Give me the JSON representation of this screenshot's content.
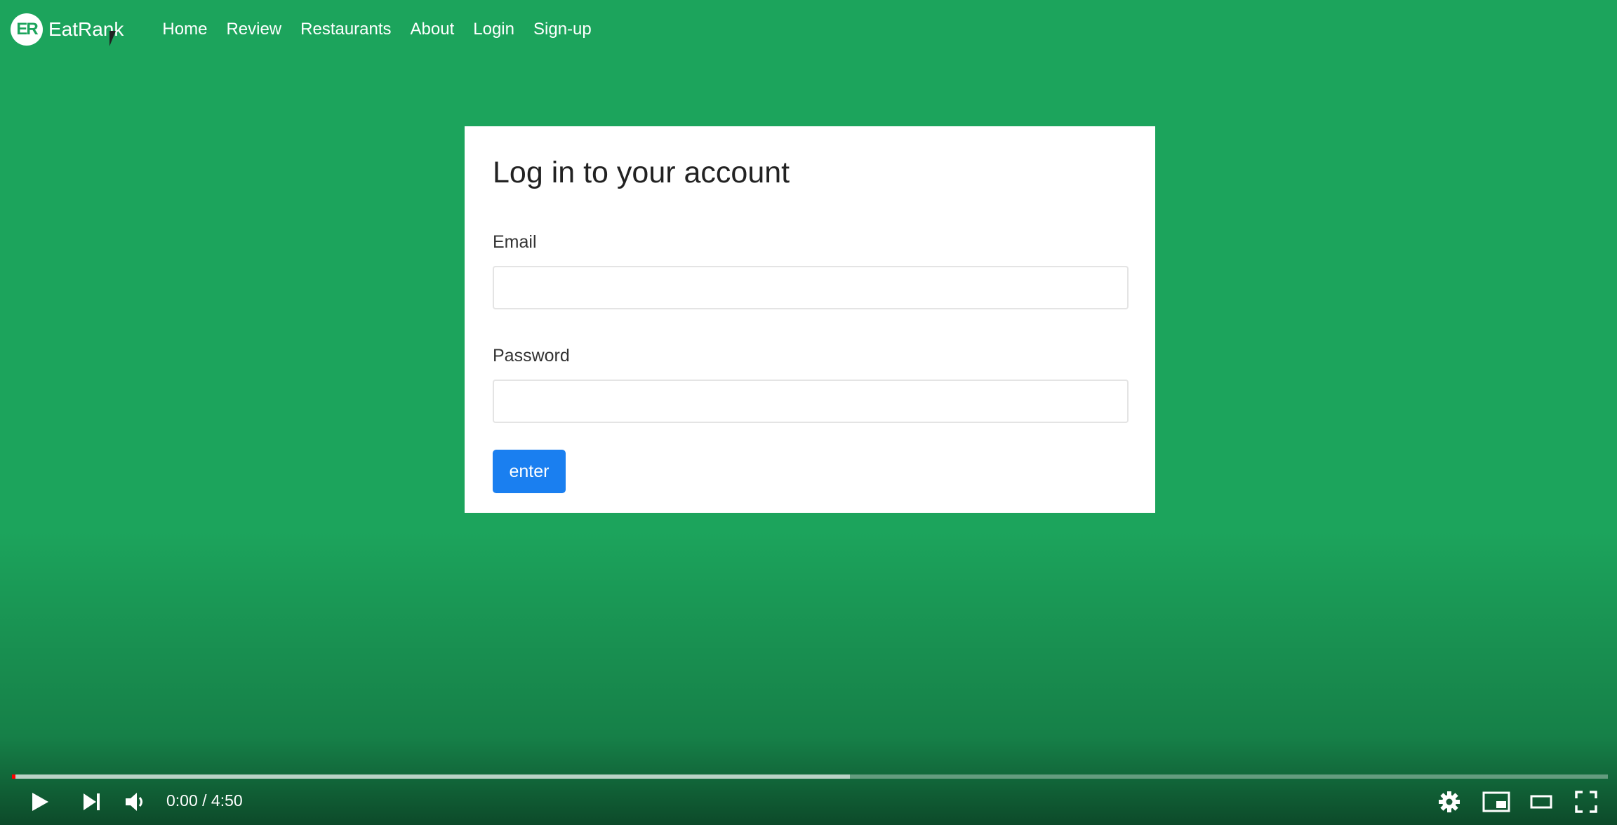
{
  "brand": {
    "logo_text": "ER",
    "name": "EatRank"
  },
  "nav": {
    "items": [
      "Home",
      "Review",
      "Restaurants",
      "About",
      "Login",
      "Sign-up"
    ]
  },
  "login": {
    "title": "Log in to your account",
    "email_label": "Email",
    "email_value": "",
    "password_label": "Password",
    "password_value": "",
    "submit_label": "enter"
  },
  "player": {
    "current_time": "0:00",
    "duration": "4:50",
    "time_text": "0:00 / 4:50",
    "buffered_fraction": 0.525,
    "played_fraction": 0.0,
    "icons": [
      "play-icon",
      "next-icon",
      "volume-icon",
      "settings-icon",
      "miniplayer-icon",
      "theater-mode-icon",
      "fullscreen-icon"
    ]
  },
  "colors": {
    "background": "#1ca45c",
    "button": "#1a7ff0",
    "progress_played": "#ff0000"
  }
}
